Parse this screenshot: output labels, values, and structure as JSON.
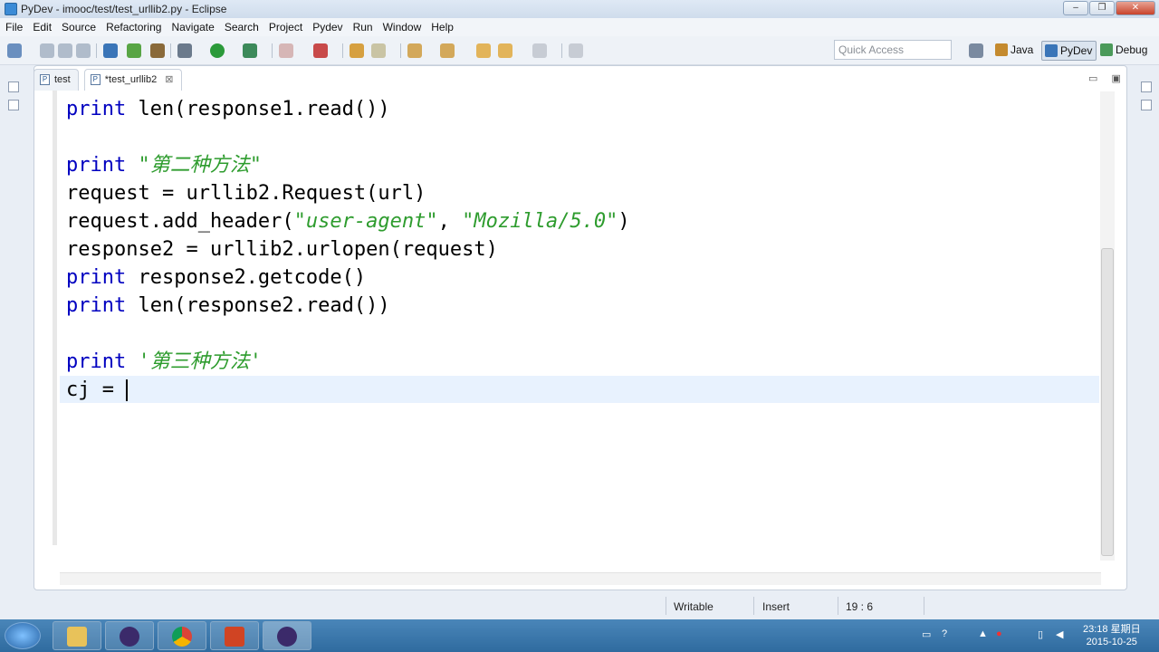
{
  "window": {
    "title": "PyDev - imooc/test/test_urllib2.py - Eclipse",
    "buttons": {
      "minimize": "–",
      "maximize": "❐",
      "close": "✕"
    }
  },
  "menu": [
    "File",
    "Edit",
    "Source",
    "Refactoring",
    "Navigate",
    "Search",
    "Project",
    "Pydev",
    "Run",
    "Window",
    "Help"
  ],
  "toolbar": {
    "quick_access_placeholder": "Quick Access"
  },
  "perspectives": [
    {
      "label": "Java",
      "active": false
    },
    {
      "label": "PyDev",
      "active": true
    },
    {
      "label": "Debug",
      "active": false
    }
  ],
  "tabs": [
    {
      "label": "test",
      "icon": "P",
      "active": false
    },
    {
      "label": "*test_urllib2",
      "icon": "P",
      "active": true,
      "close": "⊠"
    }
  ],
  "editor": {
    "lines": [
      [
        {
          "t": "print",
          "c": "kw"
        },
        {
          "t": " len(response1.read())",
          "c": ""
        }
      ],
      [],
      [
        {
          "t": "print",
          "c": "kw"
        },
        {
          "t": " ",
          "c": ""
        },
        {
          "t": "\"第二种方法\"",
          "c": "str"
        }
      ],
      [
        {
          "t": "request = urllib2.Request(url)",
          "c": ""
        }
      ],
      [
        {
          "t": "request.add_header(",
          "c": ""
        },
        {
          "t": "\"user-agent\"",
          "c": "str"
        },
        {
          "t": ", ",
          "c": ""
        },
        {
          "t": "\"Mozilla/5.0\"",
          "c": "str"
        },
        {
          "t": ")",
          "c": ""
        }
      ],
      [
        {
          "t": "response2 = urllib2.urlopen(request)",
          "c": ""
        }
      ],
      [
        {
          "t": "print",
          "c": "kw"
        },
        {
          "t": " response2.getcode()",
          "c": ""
        }
      ],
      [
        {
          "t": "print",
          "c": "kw"
        },
        {
          "t": " len(response2.read())",
          "c": ""
        }
      ],
      [],
      [
        {
          "t": "print",
          "c": "kw"
        },
        {
          "t": " ",
          "c": ""
        },
        {
          "t": "'第三种方法'",
          "c": "str"
        }
      ],
      [
        {
          "t": "cj = ",
          "c": ""
        }
      ]
    ]
  },
  "status": {
    "writable": "Writable",
    "insert": "Insert",
    "position": "19 : 6"
  },
  "taskbar": {
    "clock_time": "23:18 星期日",
    "clock_date": "2015-10-25"
  },
  "colors": {
    "keyword": "#0000c0",
    "string": "#2e9c2e",
    "current_line": "#e8f2fe"
  }
}
